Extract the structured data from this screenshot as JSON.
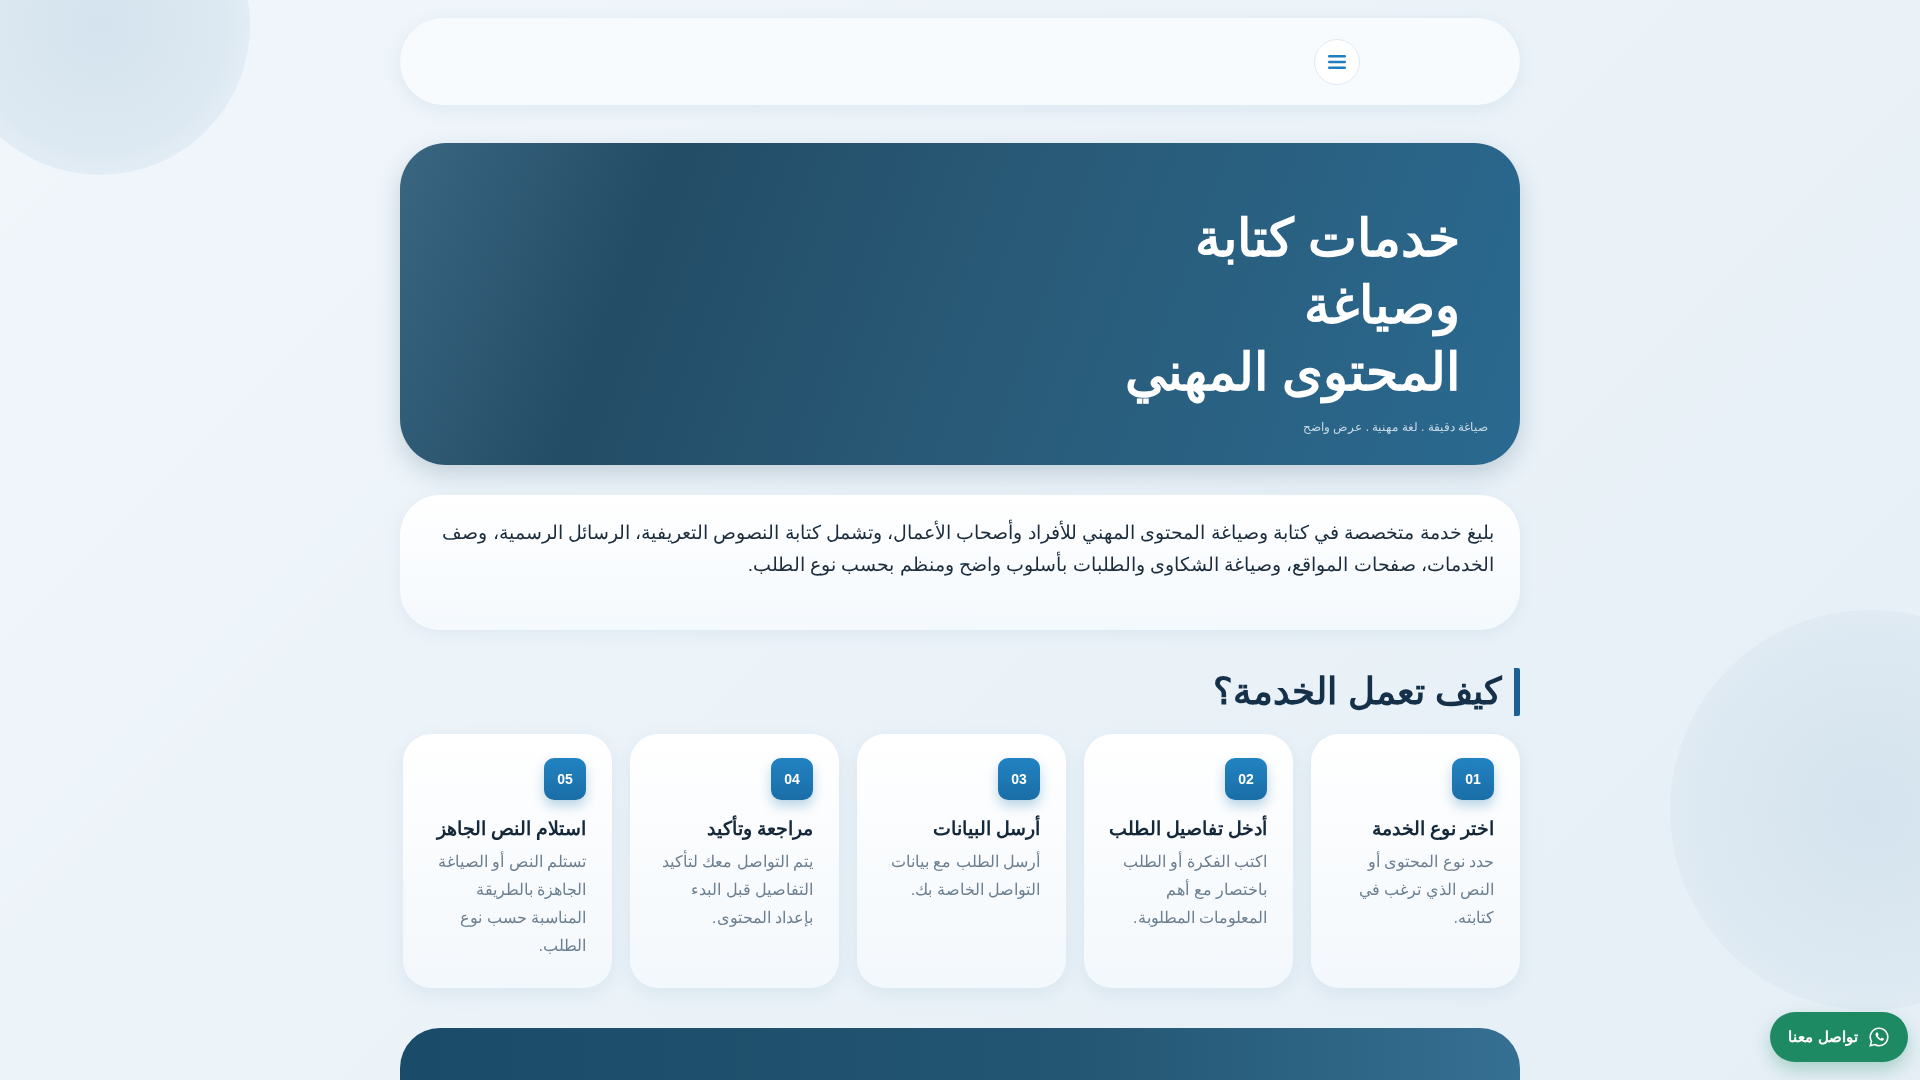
{
  "header": {
    "menu_button": {
      "kind": "menu"
    }
  },
  "hero": {
    "title_lines": [
      "خدمات كتابة",
      "وصياغة",
      "المحتوى المهني"
    ],
    "tagline": "صياغة دقيقة . لغة مهنية . عرض واضح"
  },
  "intro": {
    "text": "بليغ خدمة متخصصة في كتابة وصياغة المحتوى المهني للأفراد وأصحاب الأعمال، وتشمل كتابة النصوص التعريفية، الرسائل الرسمية، وصف الخدمات، صفحات المواقع، وصياغة الشكاوى والطلبات بأسلوب واضح ومنظم بحسب نوع الطلب."
  },
  "steps_section": {
    "heading": "كيف تعمل الخدمة؟",
    "steps": [
      {
        "number": "01",
        "title": "اختر نوع الخدمة",
        "text": "حدد نوع المحتوى أو النص الذي ترغب في كتابته."
      },
      {
        "number": "02",
        "title": "أدخل تفاصيل الطلب",
        "text": "اكتب الفكرة أو الطلب باختصار مع أهم المعلومات المطلوبة."
      },
      {
        "number": "03",
        "title": "أرسل البيانات",
        "text": "أرسل الطلب مع بيانات التواصل الخاصة بك."
      },
      {
        "number": "04",
        "title": "مراجعة وتأكيد",
        "text": "يتم التواصل معك لتأكيد التفاصيل قبل البدء بإعداد المحتوى."
      },
      {
        "number": "05",
        "title": "استلام النص الجاهز",
        "text": "تستلم النص أو الصياغة الجاهزة بالطريقة المناسبة حسب نوع الطلب."
      }
    ]
  },
  "next_panel": {
    "kind": "panel"
  },
  "contact_button": {
    "label": "تواصل معنا"
  }
}
